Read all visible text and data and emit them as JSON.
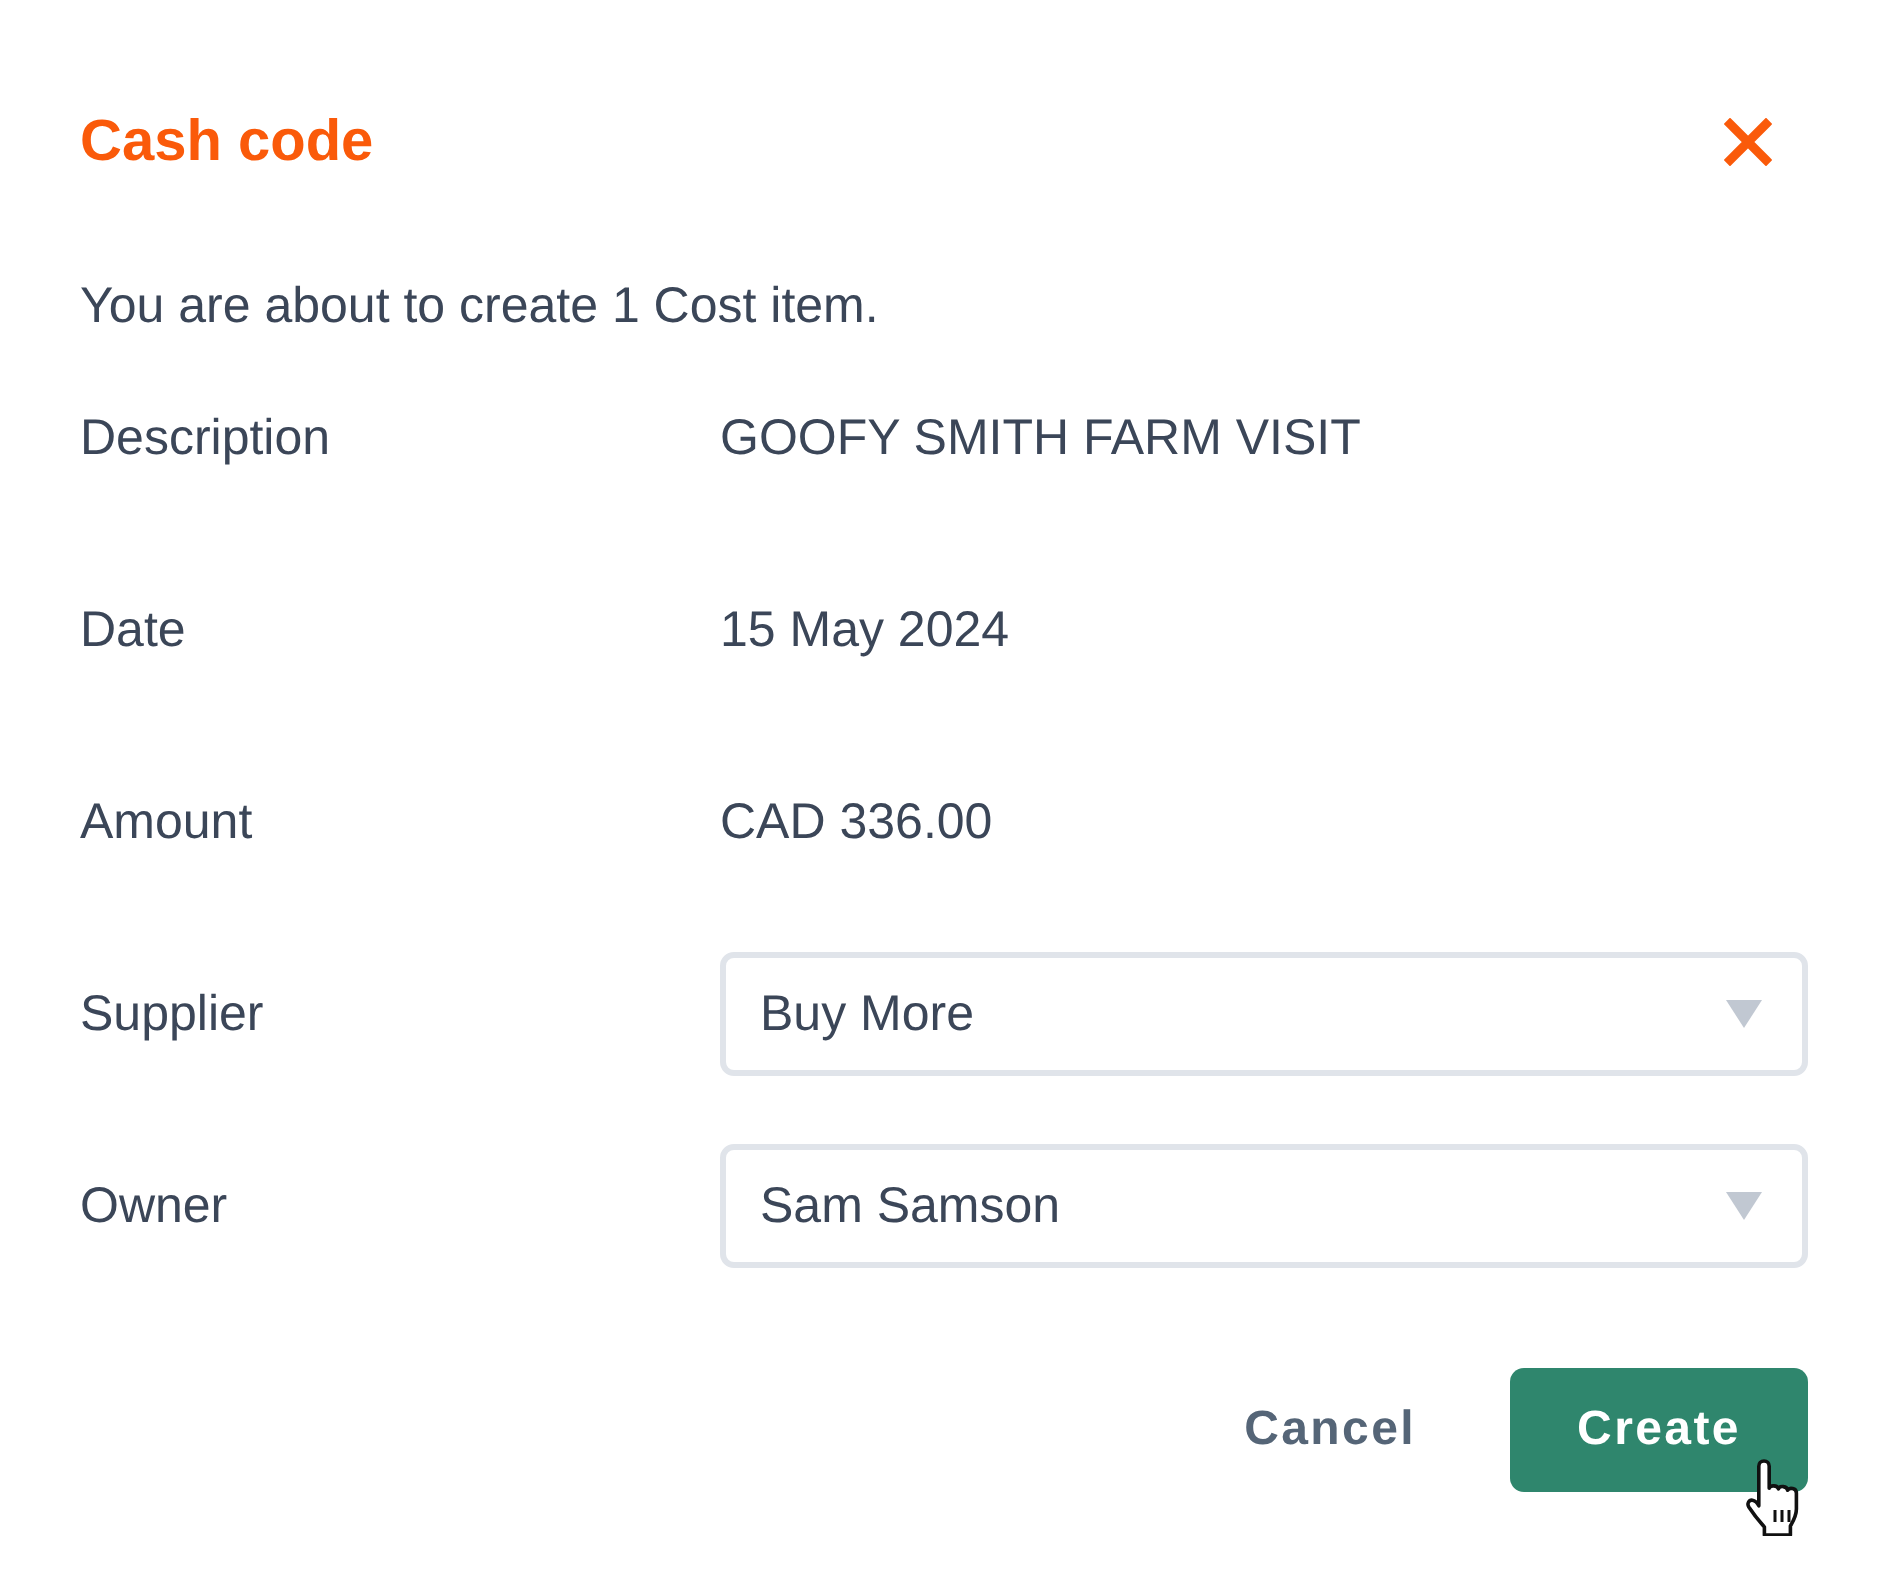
{
  "dialog": {
    "title": "Cash code"
  },
  "intro": "You are about to create 1 Cost item.",
  "fields": [
    {
      "kind": "text",
      "label": "Description",
      "value": "GOOFY SMITH FARM VISIT"
    },
    {
      "kind": "text",
      "label": "Date",
      "value": "15 May 2024"
    },
    {
      "kind": "text",
      "label": "Amount",
      "value": "CAD 336.00"
    },
    {
      "kind": "select",
      "label": "Supplier",
      "value": "Buy More"
    },
    {
      "kind": "select",
      "label": "Owner",
      "value": "Sam Samson"
    }
  ],
  "buttons": [
    {
      "kind": "secondary",
      "label": "Cancel",
      "hovered": false
    },
    {
      "kind": "primary",
      "label": "Create",
      "hovered": true
    }
  ]
}
